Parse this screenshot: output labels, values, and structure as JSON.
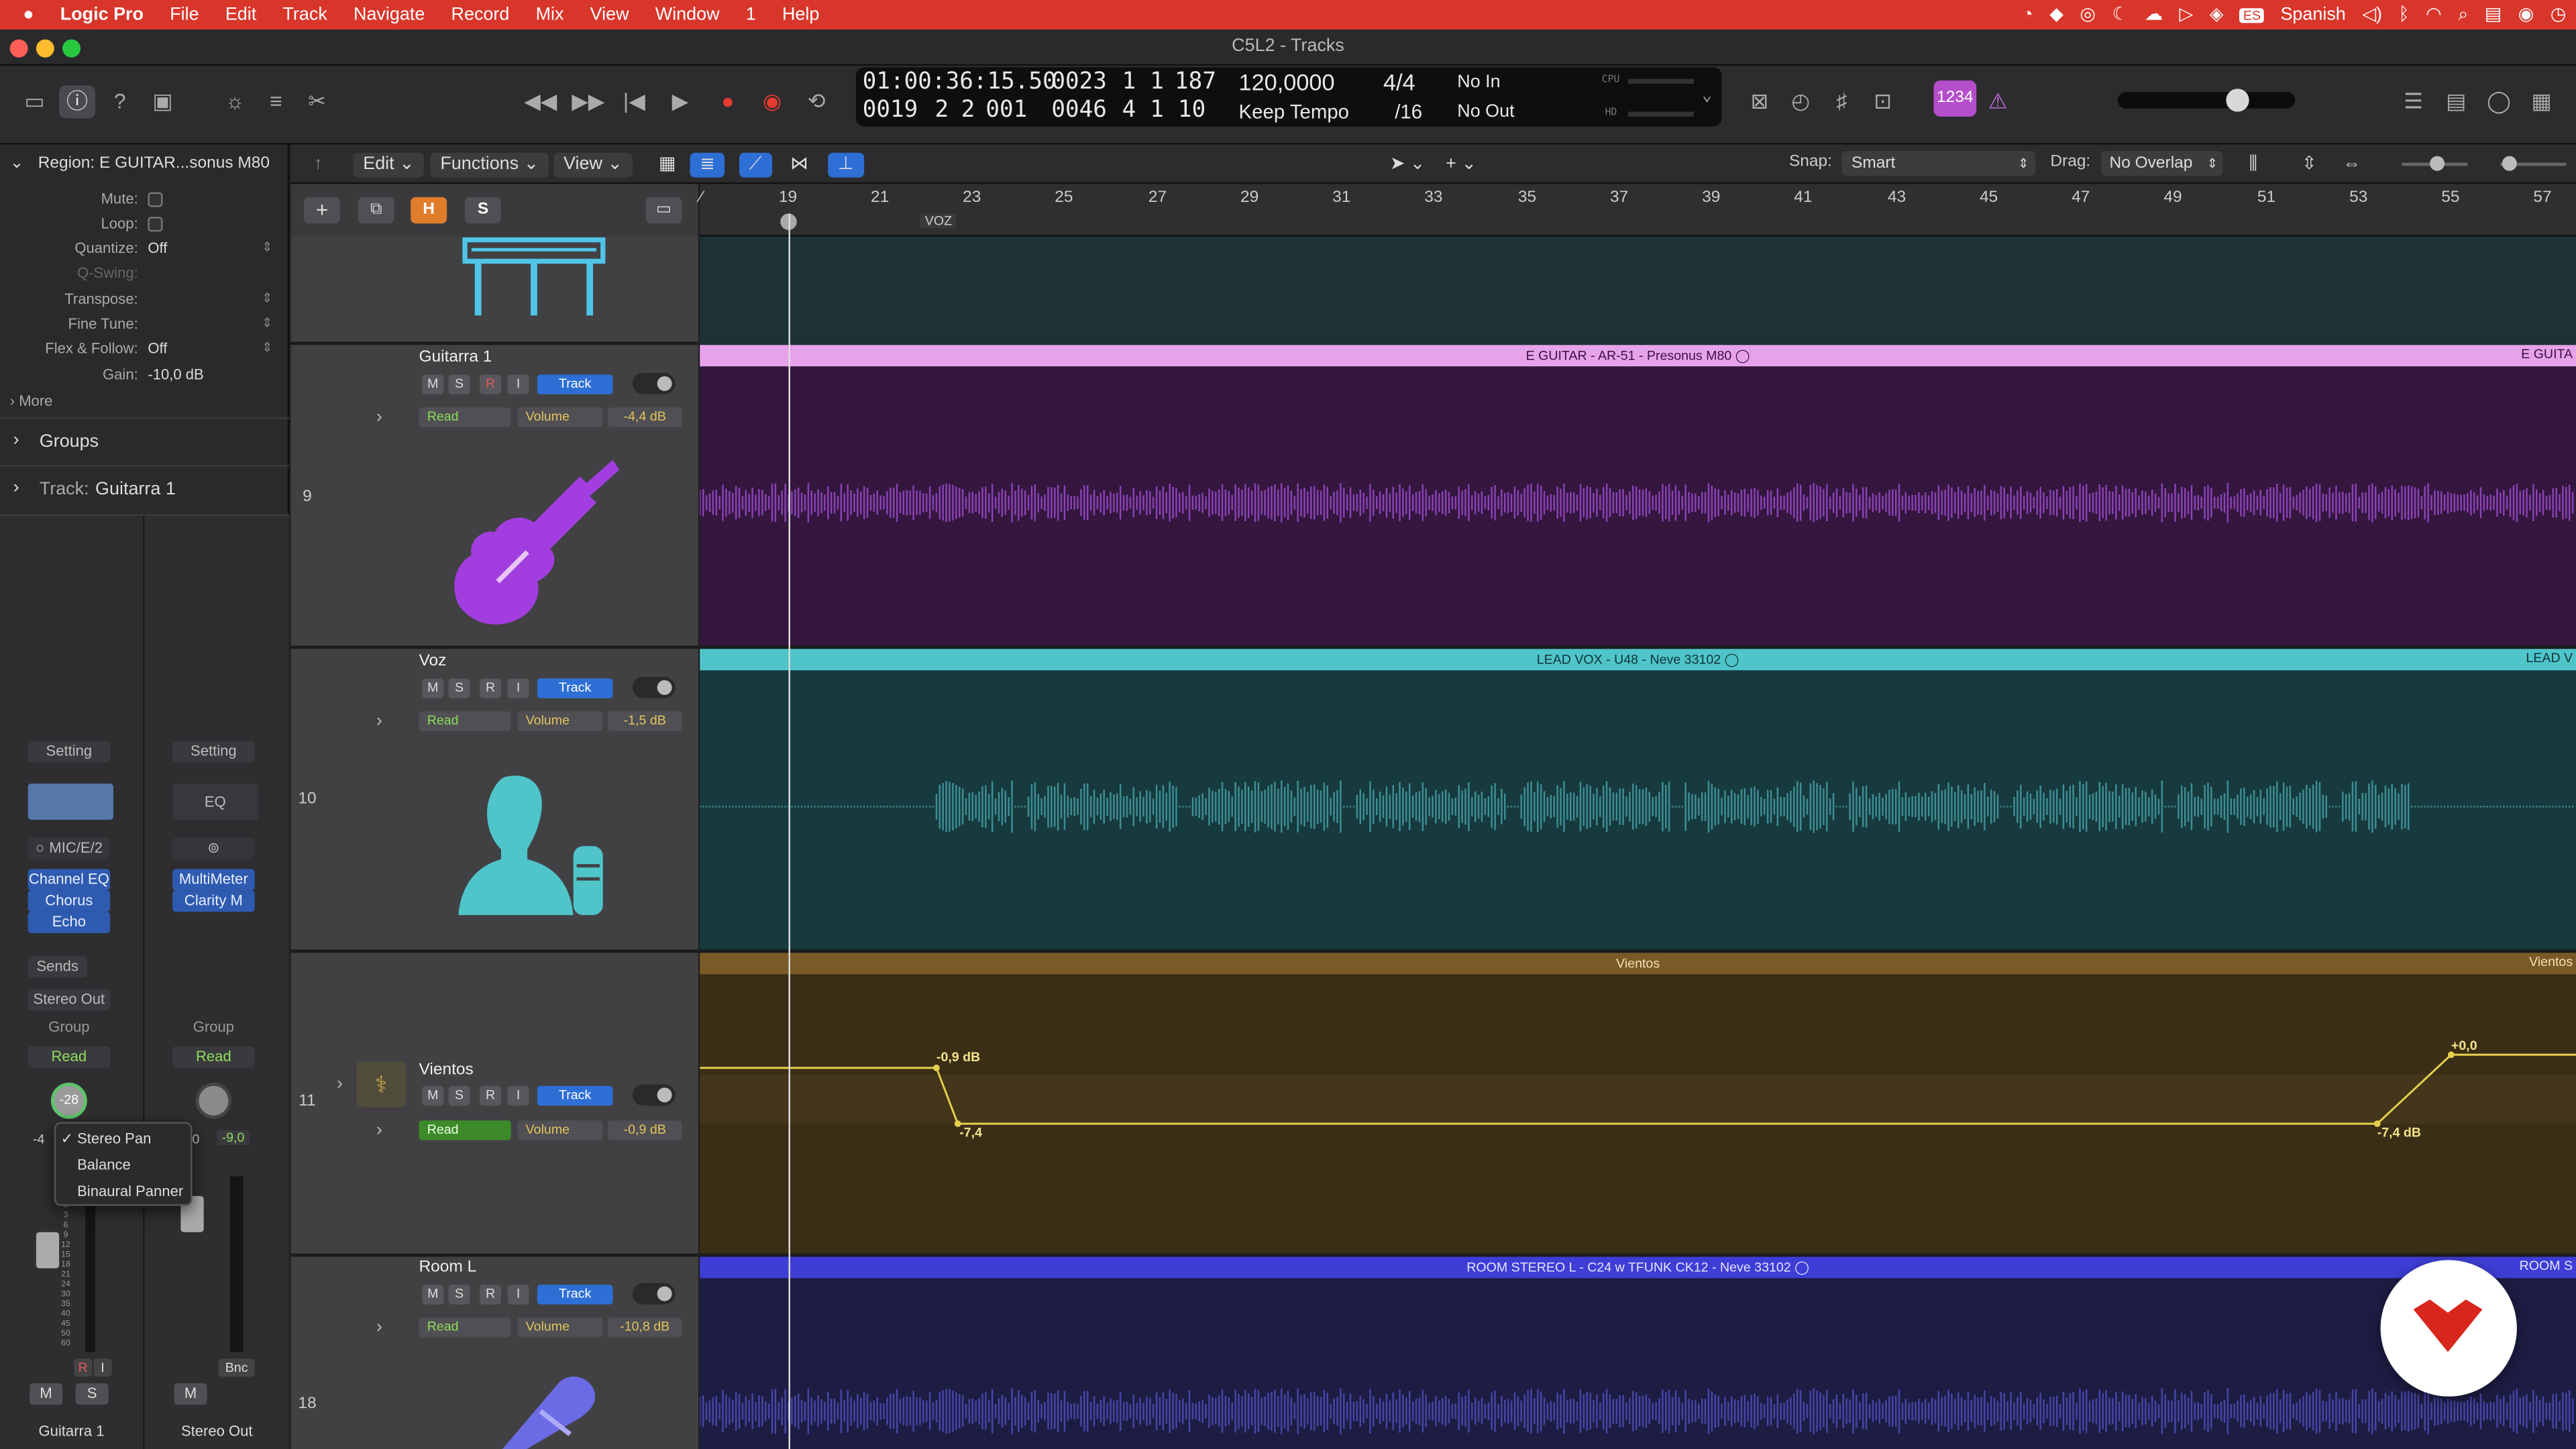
{
  "menubar": {
    "app": "Logic Pro",
    "items": [
      "File",
      "Edit",
      "Track",
      "Navigate",
      "Record",
      "Mix",
      "View",
      "Window",
      "1",
      "Help"
    ],
    "input_source": "Spanish",
    "input_badge": "ES"
  },
  "window": {
    "title": "C5L2 - Tracks"
  },
  "lcd": {
    "time": "01:00:36:15.50",
    "bars_top": "0023",
    "beat_top": "1",
    "div_top": "1",
    "tick_top": "187",
    "bars_bottom": "0019",
    "beat_bottom": "2",
    "div_bottom": "2",
    "tick_bottom": "001",
    "end_bars": "0046",
    "end_beat": "4",
    "end_div": "1",
    "end_tick": "10",
    "tempo": "120,0000",
    "tempo_mode": "Keep Tempo",
    "sig": "4/4",
    "div": "/16",
    "in": "No In",
    "out": "No Out",
    "cpu": "CPU",
    "hd": "HD"
  },
  "badge": "1234",
  "inspector": {
    "region_title": "Region: E GUITAR...sonus M80",
    "rows": [
      {
        "label": "Mute:",
        "value": ""
      },
      {
        "label": "Loop:",
        "value": ""
      },
      {
        "label": "Quantize:",
        "value": "Off"
      },
      {
        "label": "Q-Swing:",
        "value": ""
      },
      {
        "label": "Transpose:",
        "value": ""
      },
      {
        "label": "Fine Tune:",
        "value": ""
      },
      {
        "label": "Flex & Follow:",
        "value": "Off"
      },
      {
        "label": "Gain:",
        "value": "-10,0 dB"
      }
    ],
    "more": "More",
    "groups": "Groups",
    "track_label": "Track:",
    "track_name": "Guitarra 1",
    "strip1": {
      "setting": "Setting",
      "input": "MIC/E/2",
      "plugins": [
        "Channel EQ",
        "Chorus",
        "Echo"
      ],
      "sends": "Sends",
      "output": "Stereo Out",
      "group": "Group",
      "read": "Read",
      "pan": "-28",
      "db_left": "-4",
      "name": "Guitarra 1",
      "m": "M",
      "s": "S",
      "r": "R",
      "i": "I"
    },
    "strip2": {
      "setting": "Setting",
      "eq": "EQ",
      "plugins": [
        "MultiMeter",
        "Clarity M"
      ],
      "group": "Group",
      "read": "Read",
      "db_left": "0",
      "db": "-9,0",
      "name": "Stereo Out",
      "m": "M",
      "bnc": "Bnc"
    },
    "pan_menu": {
      "items": [
        "Stereo Pan",
        "Balance",
        "Binaural Panner"
      ],
      "checked": "✓"
    }
  },
  "toolbar": {
    "edit": "Edit",
    "functions": "Functions",
    "view": "View",
    "snap_label": "Snap:",
    "snap": "Smart",
    "drag_label": "Drag:",
    "drag": "No Overlap",
    "h": "H",
    "s": "S"
  },
  "ruler": {
    "bars": [
      "19",
      "21",
      "23",
      "25",
      "27",
      "29",
      "31",
      "33",
      "35",
      "37",
      "39",
      "41",
      "43",
      "45",
      "47",
      "49",
      "51",
      "53",
      "55",
      "57"
    ],
    "marker": "VOZ"
  },
  "tracks": [
    {
      "num": "9",
      "name": "Guitarra 1",
      "m": "M",
      "s": "S",
      "r": "R",
      "i": "I",
      "track": "Track",
      "read": "Read",
      "volume": "Volume",
      "db": "-4,4 dB",
      "region": "E GUITAR - AR-51 - Presonus M80",
      "region_right": "E GUITA",
      "color": "#e7a3ea"
    },
    {
      "num": "10",
      "name": "Voz",
      "m": "M",
      "s": "S",
      "r": "R",
      "i": "I",
      "track": "Track",
      "read": "Read",
      "volume": "Volume",
      "db": "-1,5 dB",
      "region": "LEAD VOX - U48 - Neve 33102",
      "region_right": "LEAD V",
      "color": "#4fc4c9"
    },
    {
      "num": "11",
      "name": "Vientos",
      "m": "M",
      "s": "S",
      "r": "R",
      "i": "I",
      "track": "Track",
      "read": "Read",
      "volume": "Volume",
      "db": "-0,9 dB",
      "region": "Vientos",
      "region_right": "Vientos",
      "color": "#b88a3a"
    },
    {
      "num": "18",
      "name": "Room L",
      "m": "M",
      "s": "S",
      "r": "R",
      "i": "I",
      "track": "Track",
      "read": "Read",
      "volume": "Volume",
      "db": "-10,8 dB",
      "region": "ROOM STEREO L - C24 w TFUNK CK12 - Neve 33102",
      "region_right": "ROOM S",
      "color": "#3e3ed6"
    }
  ],
  "automation": {
    "p1": "-0,9 dB",
    "p2": "-7,4",
    "p3": "-7,4 dB",
    "p4": "+0,0"
  }
}
